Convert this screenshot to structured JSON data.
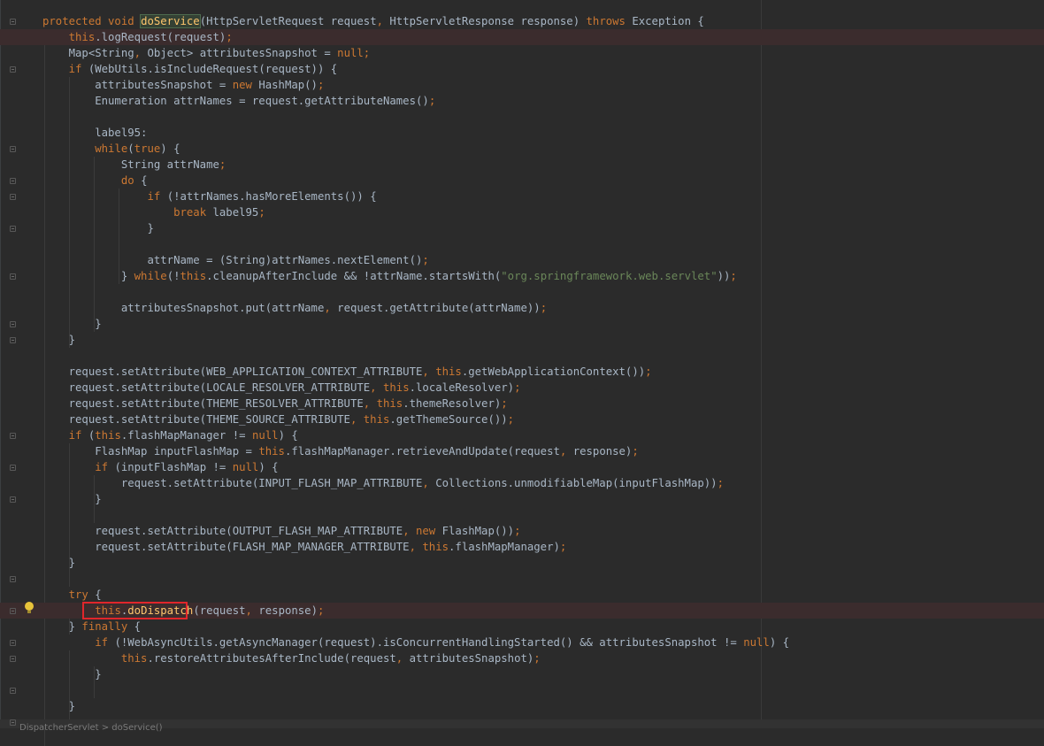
{
  "editor": {
    "bottom_text": "DispatcherServlet > doService()",
    "lines": [
      [
        {
          "t": "protected void ",
          "c": "kw"
        },
        {
          "t": "doService",
          "c": "fnhl"
        },
        {
          "t": "(HttpServletRequest request"
        },
        {
          "t": ", ",
          "c": "kw"
        },
        {
          "t": "HttpServletResponse response) "
        },
        {
          "t": "throws ",
          "c": "kw"
        },
        {
          "t": "Exception {"
        }
      ],
      [
        {
          "t": "    "
        },
        {
          "t": "this",
          "c": "kw"
        },
        {
          "t": ".logRequest(request)"
        },
        {
          "t": ";",
          "c": "kw"
        }
      ],
      [
        {
          "t": "    Map<String"
        },
        {
          "t": ", ",
          "c": "kw"
        },
        {
          "t": "Object> attributesSnapshot = "
        },
        {
          "t": "null",
          "c": "kw"
        },
        {
          "t": ";",
          "c": "kw"
        }
      ],
      [
        {
          "t": "    "
        },
        {
          "t": "if ",
          "c": "kw"
        },
        {
          "t": "(WebUtils.isIncludeRequest(request)) {"
        }
      ],
      [
        {
          "t": "        attributesSnapshot = "
        },
        {
          "t": "new ",
          "c": "kw"
        },
        {
          "t": "HashMap()"
        },
        {
          "t": ";",
          "c": "kw"
        }
      ],
      [
        {
          "t": "        Enumeration attrNames = request.getAttributeNames()"
        },
        {
          "t": ";",
          "c": "kw"
        }
      ],
      [
        {
          "t": ""
        }
      ],
      [
        {
          "t": "        label95:"
        }
      ],
      [
        {
          "t": "        "
        },
        {
          "t": "while",
          "c": "kw"
        },
        {
          "t": "("
        },
        {
          "t": "true",
          "c": "kw"
        },
        {
          "t": ") {"
        }
      ],
      [
        {
          "t": "            String attrName"
        },
        {
          "t": ";",
          "c": "kw"
        }
      ],
      [
        {
          "t": "            "
        },
        {
          "t": "do ",
          "c": "kw"
        },
        {
          "t": "{"
        }
      ],
      [
        {
          "t": "                "
        },
        {
          "t": "if ",
          "c": "kw"
        },
        {
          "t": "(!attrNames.hasMoreElements()) {"
        }
      ],
      [
        {
          "t": "                    "
        },
        {
          "t": "break ",
          "c": "kw"
        },
        {
          "t": "label95"
        },
        {
          "t": ";",
          "c": "kw"
        }
      ],
      [
        {
          "t": "                }"
        }
      ],
      [
        {
          "t": ""
        }
      ],
      [
        {
          "t": "                attrName = (String)attrNames.nextElement()"
        },
        {
          "t": ";",
          "c": "kw"
        }
      ],
      [
        {
          "t": "            } "
        },
        {
          "t": "while",
          "c": "kw"
        },
        {
          "t": "(!"
        },
        {
          "t": "this",
          "c": "kw"
        },
        {
          "t": ".cleanupAfterInclude && !attrName.startsWith("
        },
        {
          "t": "\"org.springframework.web.servlet\"",
          "c": "st"
        },
        {
          "t": "))"
        },
        {
          "t": ";",
          "c": "kw"
        }
      ],
      [
        {
          "t": ""
        }
      ],
      [
        {
          "t": "            attributesSnapshot.put(attrName"
        },
        {
          "t": ", ",
          "c": "kw"
        },
        {
          "t": "request.getAttribute(attrName))"
        },
        {
          "t": ";",
          "c": "kw"
        }
      ],
      [
        {
          "t": "        }"
        }
      ],
      [
        {
          "t": "    }"
        }
      ],
      [
        {
          "t": ""
        }
      ],
      [
        {
          "t": "    request.setAttribute(WEB_APPLICATION_CONTEXT_ATTRIBUTE"
        },
        {
          "t": ", ",
          "c": "kw"
        },
        {
          "t": "this",
          "c": "kw"
        },
        {
          "t": ".getWebApplicationContext())"
        },
        {
          "t": ";",
          "c": "kw"
        }
      ],
      [
        {
          "t": "    request.setAttribute(LOCALE_RESOLVER_ATTRIBUTE"
        },
        {
          "t": ", ",
          "c": "kw"
        },
        {
          "t": "this",
          "c": "kw"
        },
        {
          "t": ".localeResolver)"
        },
        {
          "t": ";",
          "c": "kw"
        }
      ],
      [
        {
          "t": "    request.setAttribute(THEME_RESOLVER_ATTRIBUTE"
        },
        {
          "t": ", ",
          "c": "kw"
        },
        {
          "t": "this",
          "c": "kw"
        },
        {
          "t": ".themeResolver)"
        },
        {
          "t": ";",
          "c": "kw"
        }
      ],
      [
        {
          "t": "    request.setAttribute(THEME_SOURCE_ATTRIBUTE"
        },
        {
          "t": ", ",
          "c": "kw"
        },
        {
          "t": "this",
          "c": "kw"
        },
        {
          "t": ".getThemeSource())"
        },
        {
          "t": ";",
          "c": "kw"
        }
      ],
      [
        {
          "t": "    "
        },
        {
          "t": "if ",
          "c": "kw"
        },
        {
          "t": "("
        },
        {
          "t": "this",
          "c": "kw"
        },
        {
          "t": ".flashMapManager != "
        },
        {
          "t": "null",
          "c": "kw"
        },
        {
          "t": ") {"
        }
      ],
      [
        {
          "t": "        FlashMap inputFlashMap = "
        },
        {
          "t": "this",
          "c": "kw"
        },
        {
          "t": ".flashMapManager.retrieveAndUpdate(request"
        },
        {
          "t": ", ",
          "c": "kw"
        },
        {
          "t": "response)"
        },
        {
          "t": ";",
          "c": "kw"
        }
      ],
      [
        {
          "t": "        "
        },
        {
          "t": "if ",
          "c": "kw"
        },
        {
          "t": "(inputFlashMap != "
        },
        {
          "t": "null",
          "c": "kw"
        },
        {
          "t": ") {"
        }
      ],
      [
        {
          "t": "            request.setAttribute(INPUT_FLASH_MAP_ATTRIBUTE"
        },
        {
          "t": ", ",
          "c": "kw"
        },
        {
          "t": "Collections.unmodifiableMap(inputFlashMap))"
        },
        {
          "t": ";",
          "c": "kw"
        }
      ],
      [
        {
          "t": "        }"
        }
      ],
      [
        {
          "t": ""
        }
      ],
      [
        {
          "t": "        request.setAttribute(OUTPUT_FLASH_MAP_ATTRIBUTE"
        },
        {
          "t": ", ",
          "c": "kw"
        },
        {
          "t": "new ",
          "c": "kw"
        },
        {
          "t": "FlashMap())"
        },
        {
          "t": ";",
          "c": "kw"
        }
      ],
      [
        {
          "t": "        request.setAttribute(FLASH_MAP_MANAGER_ATTRIBUTE"
        },
        {
          "t": ", ",
          "c": "kw"
        },
        {
          "t": "this",
          "c": "kw"
        },
        {
          "t": ".flashMapManager)"
        },
        {
          "t": ";",
          "c": "kw"
        }
      ],
      [
        {
          "t": "    }"
        }
      ],
      [
        {
          "t": ""
        }
      ],
      [
        {
          "t": "    "
        },
        {
          "t": "try ",
          "c": "kw"
        },
        {
          "t": "{"
        }
      ],
      [
        {
          "t": "        "
        },
        {
          "t": "this",
          "c": "kw"
        },
        {
          "t": "."
        },
        {
          "t": "doDispatch",
          "c": "fn"
        },
        {
          "t": "(request"
        },
        {
          "t": ", ",
          "c": "kw"
        },
        {
          "t": "response)"
        },
        {
          "t": ";",
          "c": "kw"
        }
      ],
      [
        {
          "t": "    } "
        },
        {
          "t": "finally ",
          "c": "kw"
        },
        {
          "t": "{"
        }
      ],
      [
        {
          "t": "        "
        },
        {
          "t": "if ",
          "c": "kw"
        },
        {
          "t": "(!WebAsyncUtils.getAsyncManager(request).isConcurrentHandlingStarted() && attributesSnapshot != "
        },
        {
          "t": "null",
          "c": "kw"
        },
        {
          "t": ") {"
        }
      ],
      [
        {
          "t": "            "
        },
        {
          "t": "this",
          "c": "kw"
        },
        {
          "t": ".restoreAttributesAfterInclude(request"
        },
        {
          "t": ", ",
          "c": "kw"
        },
        {
          "t": "attributesSnapshot)"
        },
        {
          "t": ";",
          "c": "kw"
        }
      ],
      [
        {
          "t": "        }"
        }
      ],
      [
        {
          "t": ""
        }
      ],
      [
        {
          "t": "    }"
        }
      ]
    ]
  }
}
